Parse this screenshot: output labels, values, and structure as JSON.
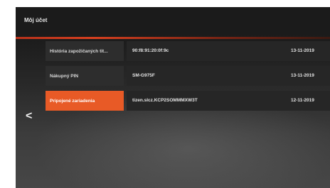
{
  "header": {
    "title": "Môj účet"
  },
  "nav": {
    "back_icon": "<"
  },
  "menu": {
    "items": [
      {
        "label": "História zapožičaných tit..."
      },
      {
        "label": "Nákupný PIN"
      },
      {
        "label": "Pripojené zariadenia"
      }
    ]
  },
  "devices": {
    "rows": [
      {
        "value": "90:f8:91:20:0f:9c",
        "date": "13-11-2019"
      },
      {
        "value": "SM-G975F",
        "date": "13-11-2019"
      },
      {
        "value": "tizen.slcz.KCP2SOMMMXW3T",
        "date": "12-11-2019"
      }
    ]
  },
  "colors": {
    "accent": "#e85a26",
    "background": "#1b1b1b"
  }
}
